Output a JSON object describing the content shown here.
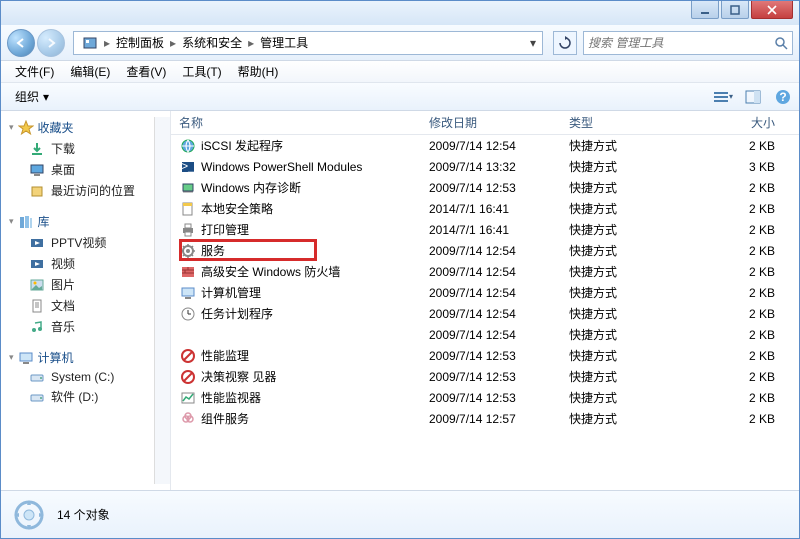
{
  "titlebar": {
    "min_tooltip": "最小化",
    "max_tooltip": "最大化",
    "close_tooltip": "关闭"
  },
  "breadcrumb": {
    "root_icon": "control-panel-icon",
    "items": [
      "控制面板",
      "系统和安全",
      "管理工具"
    ]
  },
  "search": {
    "placeholder": "搜索 管理工具"
  },
  "menubar": {
    "file": "文件(F)",
    "edit": "编辑(E)",
    "view": "查看(V)",
    "tools": "工具(T)",
    "help": "帮助(H)"
  },
  "toolbar": {
    "organize": "组织"
  },
  "sidebar": {
    "favorites": {
      "label": "收藏夹",
      "items": [
        {
          "icon": "download-icon",
          "label": "下载"
        },
        {
          "icon": "desktop-icon",
          "label": "桌面"
        },
        {
          "icon": "recent-icon",
          "label": "最近访问的位置"
        }
      ]
    },
    "libraries": {
      "label": "库",
      "items": [
        {
          "icon": "video-icon",
          "label": "PPTV视频"
        },
        {
          "icon": "video-icon",
          "label": "视频"
        },
        {
          "icon": "pictures-icon",
          "label": "图片"
        },
        {
          "icon": "documents-icon",
          "label": "文档"
        },
        {
          "icon": "music-icon",
          "label": "音乐"
        }
      ]
    },
    "computer": {
      "label": "计算机",
      "items": [
        {
          "icon": "drive-icon",
          "label": "System (C:)"
        },
        {
          "icon": "drive-icon",
          "label": "软件 (D:)"
        }
      ]
    }
  },
  "columns": {
    "name": "名称",
    "date": "修改日期",
    "type": "类型",
    "size": "大小"
  },
  "files": [
    {
      "icon": "globe-icon",
      "name": "iSCSI 发起程序",
      "date": "2009/7/14 12:54",
      "type": "快捷方式",
      "size": "2 KB"
    },
    {
      "icon": "ps-icon",
      "name": "Windows PowerShell Modules",
      "date": "2009/7/14 13:32",
      "type": "快捷方式",
      "size": "3 KB"
    },
    {
      "icon": "mem-icon",
      "name": "Windows 内存诊断",
      "date": "2009/7/14 12:53",
      "type": "快捷方式",
      "size": "2 KB"
    },
    {
      "icon": "policy-icon",
      "name": "本地安全策略",
      "date": "2014/7/1 16:41",
      "type": "快捷方式",
      "size": "2 KB"
    },
    {
      "icon": "print-icon",
      "name": "打印管理",
      "date": "2014/7/1 16:41",
      "type": "快捷方式",
      "size": "2 KB"
    },
    {
      "icon": "gear-icon",
      "name": "服务",
      "date": "2009/7/14 12:54",
      "type": "快捷方式",
      "size": "2 KB",
      "highlighted": true
    },
    {
      "icon": "firewall-icon",
      "name": "高级安全 Windows 防火墙",
      "date": "2009/7/14 12:54",
      "type": "快捷方式",
      "size": "2 KB"
    },
    {
      "icon": "computer-icon",
      "name": "计算机管理",
      "date": "2009/7/14 12:54",
      "type": "快捷方式",
      "size": "2 KB"
    },
    {
      "icon": "task-icon",
      "name": "任务计划程序",
      "date": "2009/7/14 12:54",
      "type": "快捷方式",
      "size": "2 KB"
    },
    {
      "icon": "blank-icon",
      "name": "",
      "date": "2009/7/14 12:54",
      "type": "快捷方式",
      "size": "2 KB"
    },
    {
      "icon": "blocked-icon",
      "name": "性能监理",
      "date": "2009/7/14 12:53",
      "type": "快捷方式",
      "size": "2 KB"
    },
    {
      "icon": "blocked-icon",
      "name": "决策视察               见器",
      "date": "2009/7/14 12:53",
      "type": "快捷方式",
      "size": "2 KB"
    },
    {
      "icon": "perf-icon",
      "name": "性能监视器",
      "date": "2009/7/14 12:53",
      "type": "快捷方式",
      "size": "2 KB"
    },
    {
      "icon": "component-icon",
      "name": "组件服务",
      "date": "2009/7/14 12:57",
      "type": "快捷方式",
      "size": "2 KB"
    }
  ],
  "statusbar": {
    "count_text": "14 个对象"
  }
}
